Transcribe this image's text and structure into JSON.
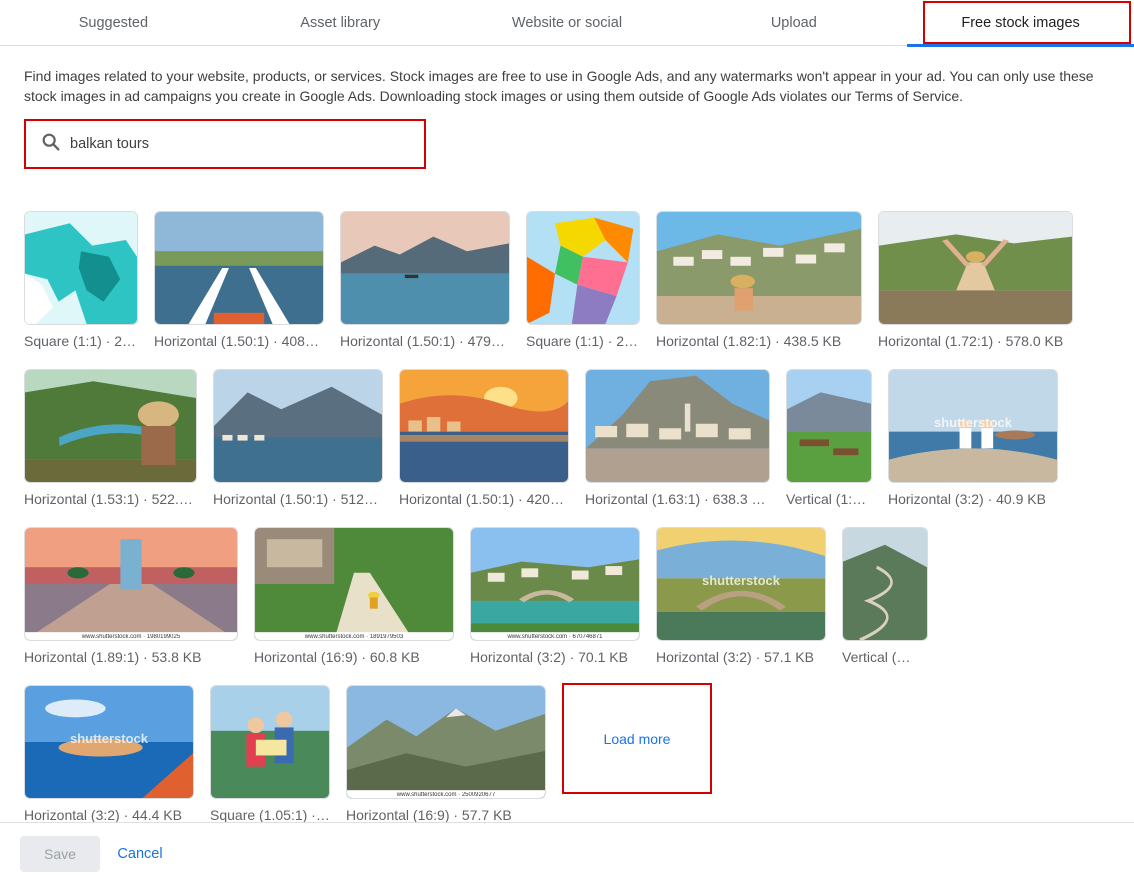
{
  "tabs": [
    {
      "label": "Suggested"
    },
    {
      "label": "Asset library"
    },
    {
      "label": "Website or social"
    },
    {
      "label": "Upload"
    },
    {
      "label": "Free stock images",
      "active": true
    }
  ],
  "description": "Find images related to your website, products, or services. Stock images are free to use in Google Ads, and any watermarks won't appear in your ad. You can only use these stock images in ad campaigns you create in Google Ads. Downloading stock images or using them outside of Google Ads violates our Terms of Service.",
  "search": {
    "value": "balkan tours",
    "icon": "search-icon"
  },
  "images": [
    {
      "caption": "Square (1:1) · 2…",
      "subject": "map-teal",
      "watermark": ""
    },
    {
      "caption": "Horizontal (1.50:1) · 408…",
      "subject": "boat-lake",
      "watermark": ""
    },
    {
      "caption": "Horizontal (1.50:1) · 479…",
      "subject": "lake-mountains",
      "watermark": ""
    },
    {
      "caption": "Square (1:1) · 2…",
      "subject": "map-colorful",
      "watermark": ""
    },
    {
      "caption": "Horizontal (1.82:1) · 438.5 KB",
      "subject": "town-hill",
      "watermark": ""
    },
    {
      "caption": "Horizontal (1.72:1) · 578.0 KB",
      "subject": "hiker-arms",
      "watermark": ""
    },
    {
      "caption": "Horizontal (1.53:1) · 522.…",
      "subject": "river-woman",
      "watermark": ""
    },
    {
      "caption": "Horizontal (1.50:1) · 512…",
      "subject": "kotor-bay",
      "watermark": ""
    },
    {
      "caption": "Horizontal (1.50:1) · 420…",
      "subject": "sunset-harbor",
      "watermark": ""
    },
    {
      "caption": "Horizontal (1.63:1) · 638.3 …",
      "subject": "berat-town",
      "watermark": ""
    },
    {
      "caption": "Vertical (1:…",
      "subject": "meadow",
      "watermark": ""
    },
    {
      "caption": "Horizontal (3:2) · 40.9 KB",
      "subject": "sea-viewpoint",
      "watermark": "shutterstock"
    },
    {
      "caption": "Horizontal (1.89:1) · 53.8 KB",
      "subject": "pier",
      "watermark": "www.shutterstock.com · 1980199025"
    },
    {
      "caption": "Horizontal (16:9) · 60.8 KB",
      "subject": "forest-path",
      "watermark": "www.shutterstock.com · 1891979503"
    },
    {
      "caption": "Horizontal (3:2) · 70.1 KB",
      "subject": "mostar-river",
      "watermark": "www.shutterstock.com · 670746871"
    },
    {
      "caption": "Horizontal (3:2) · 57.1 KB",
      "subject": "mostar-bridge",
      "watermark": "shutterstock"
    },
    {
      "caption": "Vertical (…",
      "subject": "serpentine-road",
      "watermark": ""
    },
    {
      "caption": "Horizontal (3:2) · 44.4 KB",
      "subject": "island-sea",
      "watermark": "shutterstock"
    },
    {
      "caption": "Square (1.05:1) · …",
      "subject": "couple-map",
      "watermark": ""
    },
    {
      "caption": "Horizontal (16:9) · 57.7 KB",
      "subject": "mountain-range",
      "watermark": "www.shutterstock.com · 2500920677"
    }
  ],
  "load_more_label": "Load more",
  "footer": {
    "save_label": "Save",
    "cancel_label": "Cancel"
  },
  "colors": {
    "accent": "#1a73e8",
    "highlight": "#d50000",
    "border": "#dadce0"
  }
}
